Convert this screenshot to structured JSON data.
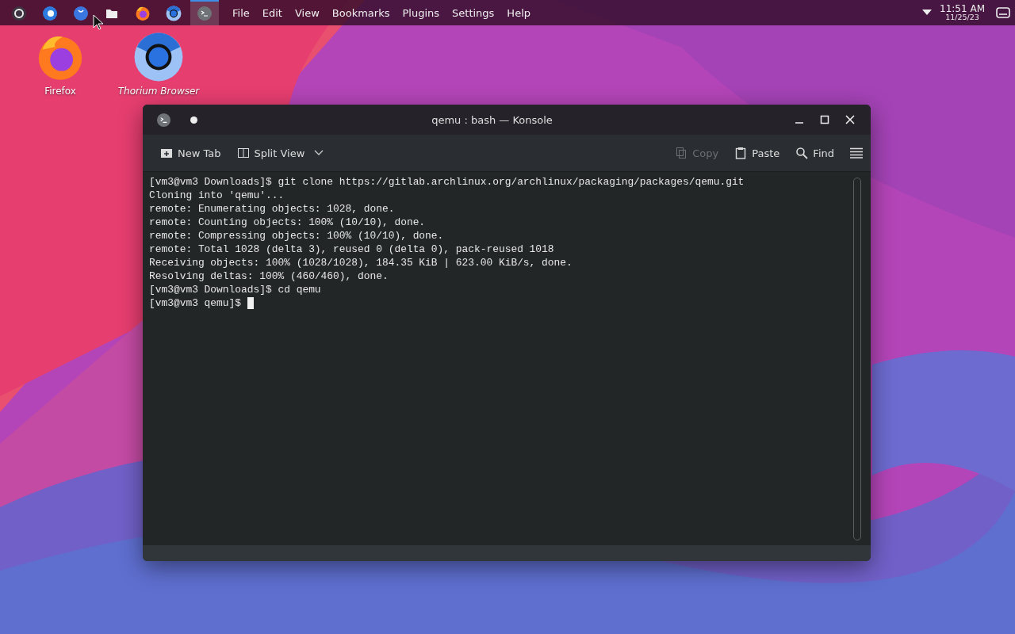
{
  "panel": {
    "apps": [
      {
        "kind": "launcher",
        "selected": false
      },
      {
        "kind": "toggle",
        "selected": false
      },
      {
        "kind": "smile",
        "selected": false
      },
      {
        "kind": "folder",
        "selected": false
      },
      {
        "kind": "firefox",
        "selected": false
      },
      {
        "kind": "browser",
        "selected": false
      },
      {
        "kind": "terminal",
        "selected": true
      }
    ],
    "menu": [
      "File",
      "Edit",
      "View",
      "Bookmarks",
      "Plugins",
      "Settings",
      "Help"
    ],
    "clock": {
      "time": "11:51 AM",
      "date": "11/25/23"
    }
  },
  "desktop_icons": [
    {
      "kind": "firefox",
      "label": "Firefox",
      "italic": false
    },
    {
      "kind": "browser",
      "label": "Thorium Browser",
      "italic": true
    }
  ],
  "window": {
    "title": "qemu : bash — Konsole",
    "toolbar": {
      "left": [
        {
          "kind": "new-tab",
          "label": "New Tab",
          "disabled": false
        },
        {
          "kind": "split",
          "label": "Split View",
          "disabled": false
        }
      ],
      "right": [
        {
          "kind": "copy",
          "label": "Copy",
          "disabled": true
        },
        {
          "kind": "paste",
          "label": "Paste",
          "disabled": false
        },
        {
          "kind": "find",
          "label": "Find",
          "disabled": false
        }
      ]
    },
    "terminal": {
      "lines": [
        {
          "text": "[vm3@vm3 Downloads]$ git clone https://gitlab.archlinux.org/archlinux/packaging/packages/qemu.git",
          "cursor": false
        },
        {
          "text": "Cloning into 'qemu'...",
          "cursor": false
        },
        {
          "text": "remote: Enumerating objects: 1028, done.",
          "cursor": false
        },
        {
          "text": "remote: Counting objects: 100% (10/10), done.",
          "cursor": false
        },
        {
          "text": "remote: Compressing objects: 100% (10/10), done.",
          "cursor": false
        },
        {
          "text": "remote: Total 1028 (delta 3), reused 0 (delta 0), pack-reused 1018",
          "cursor": false
        },
        {
          "text": "Receiving objects: 100% (1028/1028), 184.35 KiB | 623.00 KiB/s, done.",
          "cursor": false
        },
        {
          "text": "Resolving deltas: 100% (460/460), done.",
          "cursor": false
        },
        {
          "text": "[vm3@vm3 Downloads]$ cd qemu",
          "cursor": false
        },
        {
          "text": "[vm3@vm3 qemu]$",
          "cursor": true
        }
      ]
    }
  }
}
